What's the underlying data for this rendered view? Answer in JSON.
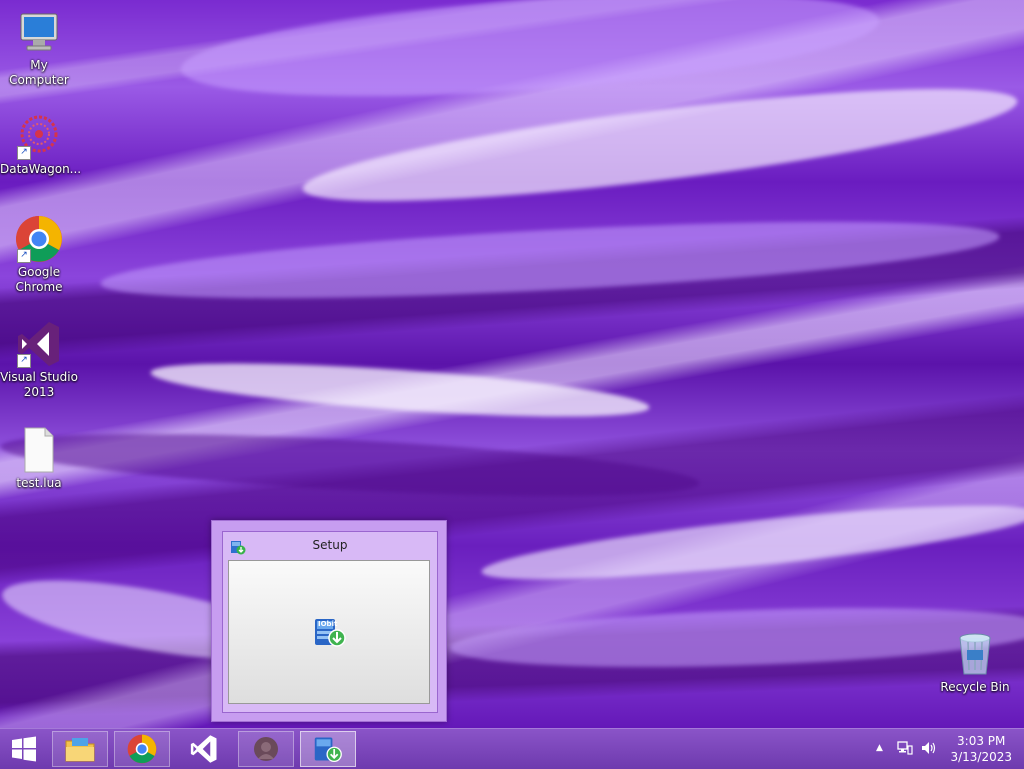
{
  "desktop": {
    "icons": [
      {
        "label": "My Computer",
        "icon": "computer-icon"
      },
      {
        "label": "DataWagon...",
        "icon": "datawagon-icon"
      },
      {
        "label": "Google Chrome",
        "icon": "chrome-icon"
      },
      {
        "label": "Visual Studio 2013",
        "icon": "visual-studio-icon"
      },
      {
        "label": "test.lua",
        "icon": "file-icon"
      },
      {
        "label": "Recycle Bin",
        "icon": "recycle-bin-icon"
      }
    ]
  },
  "setup_window": {
    "title": "Setup",
    "icon": "iobit-installer-icon",
    "content_icon": "iobit-logo-icon",
    "logo_text": "IObit"
  },
  "taskbar": {
    "start_icon": "windows-start-icon",
    "pinned": [
      "file-explorer-icon",
      "chrome-icon",
      "visual-studio-icon",
      "app-icon",
      "iobit-icon"
    ],
    "tray": {
      "chevron": "▲"
    },
    "clock": {
      "time": "3:03 PM",
      "date": "3/13/2023"
    }
  },
  "colors": {
    "accent": "#8a54c8",
    "wallpaper": "#7a2bd0"
  }
}
